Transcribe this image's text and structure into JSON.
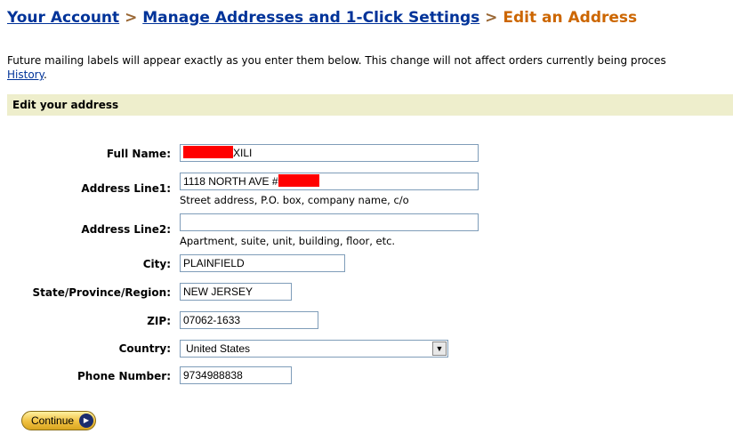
{
  "breadcrumb": {
    "link1": "Your Account",
    "sep1": " > ",
    "link2": "Manage Addresses and 1-Click Settings",
    "sep2": " > ",
    "current": "Edit an Address"
  },
  "intro": {
    "text": "Future mailing labels will appear exactly as you enter them below. This change will not affect orders currently being proces",
    "link": "History",
    "suffix": "."
  },
  "section_title": "Edit your address",
  "form": {
    "full_name": {
      "label": "Full Name:",
      "value": "XILI"
    },
    "address1": {
      "label": "Address Line1:",
      "value": "1118 NORTH AVE #",
      "hint": "Street address, P.O. box, company name, c/o"
    },
    "address2": {
      "label": "Address Line2:",
      "value": "",
      "hint": "Apartment, suite, unit, building, floor, etc."
    },
    "city": {
      "label": "City:",
      "value": "PLAINFIELD"
    },
    "state": {
      "label": "State/Province/Region:",
      "value": "NEW JERSEY"
    },
    "zip": {
      "label": "ZIP:",
      "value": "07062-1633"
    },
    "country": {
      "label": "Country:",
      "value": "United States"
    },
    "phone": {
      "label": "Phone Number:",
      "value": "9734988838"
    }
  },
  "continue_label": "Continue",
  "colors": {
    "link": "#003399",
    "current_crumb": "#cc6600",
    "section_bg": "#eeeecc",
    "redaction": "#ff0000"
  }
}
